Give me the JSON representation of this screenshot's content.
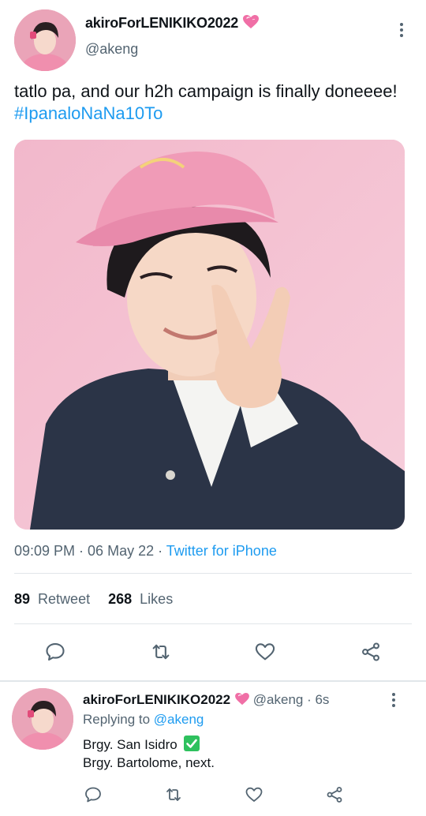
{
  "tweet": {
    "display_name": "akiroForLENIKIKO2022",
    "handle": "@akeng",
    "text_plain": "tatlo pa, and our h2h campaign is finally doneeee! ",
    "hashtag": "#IpanaloNaNa10To",
    "time": "09:09 PM",
    "separator": " · ",
    "date": "06 May 22",
    "source": "Twitter for iPhone",
    "retweet_count": "89",
    "retweet_label": "Retweet",
    "likes_count": "268",
    "likes_label": "Likes"
  },
  "reply": {
    "display_name": "akiroForLENIKIKO2022",
    "handle_time": "@akeng · 6s",
    "replying_prefix": "Replying to ",
    "replying_to": "@akeng",
    "line1": "Brgy. San Isidro",
    "line2": "Brgy. Bartolome, next."
  },
  "icons": {
    "verified_emoji": "heart-emoji",
    "check_emoji": "check-mark-emoji",
    "actions": [
      "reply-icon",
      "retweet-icon",
      "like-icon",
      "share-icon"
    ]
  },
  "colors": {
    "accent": "#1d9bf0",
    "secondary_text": "#536471",
    "primary_text": "#0f1419",
    "divider": "#e1e6ea"
  }
}
